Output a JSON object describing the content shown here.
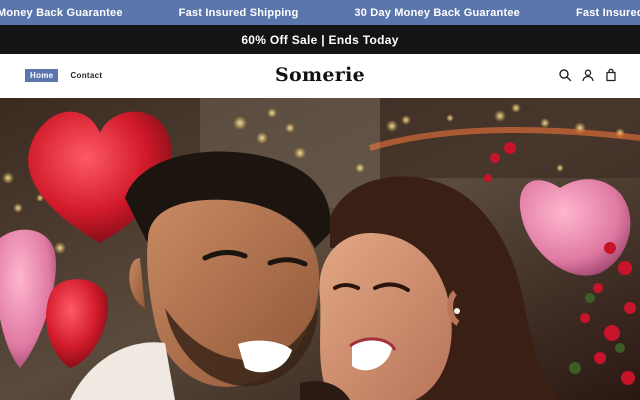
{
  "announcement": {
    "items": [
      "Money Back Guarantee",
      "Fast Insured Shipping",
      "30 Day Money Back Guarantee",
      "Fast Insured Shipping"
    ]
  },
  "sale_bar": {
    "text": "60% Off Sale | Ends Today"
  },
  "header": {
    "nav": [
      {
        "label": "Home",
        "active": true
      },
      {
        "label": "Contact",
        "active": false
      }
    ],
    "logo": "Somerie",
    "icons": [
      "search-icon",
      "account-icon",
      "cart-icon"
    ]
  },
  "hero": {
    "image": "photo of smiling couple foreheads touching, heart balloons and string lights behind",
    "colors": {
      "accent": "#5b76ad",
      "bar": "#141414"
    }
  }
}
